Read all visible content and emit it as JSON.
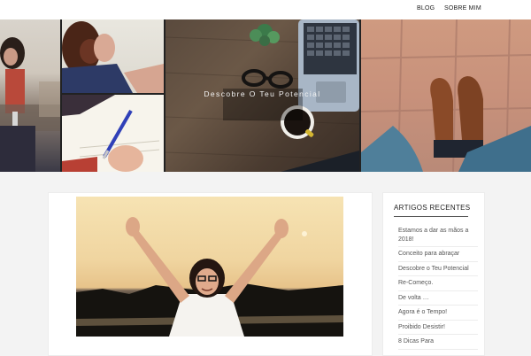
{
  "nav": {
    "items": [
      {
        "label": "BLOG"
      },
      {
        "label": "SOBRE MIM"
      }
    ]
  },
  "hero": {
    "title": "Descobre O Teu Potencial"
  },
  "sidebar": {
    "title": "ARTIGOS RECENTES",
    "items": [
      {
        "label": "Estamos a dar as mãos a 2018!"
      },
      {
        "label": "Conceito para abraçar"
      },
      {
        "label": "Descobre o Teu Potencial"
      },
      {
        "label": "Re-Começo."
      },
      {
        "label": "De volta …"
      },
      {
        "label": "Agora é o Tempo!"
      },
      {
        "label": "Proibido Desistir!"
      },
      {
        "label": "8 Dicas Para"
      }
    ]
  },
  "icons": {
    "coffee": "coffee-cup-icon",
    "glasses": "glasses-icon",
    "plant": "plant-icon",
    "laptop": "laptop-icon",
    "pen": "pen-icon"
  }
}
